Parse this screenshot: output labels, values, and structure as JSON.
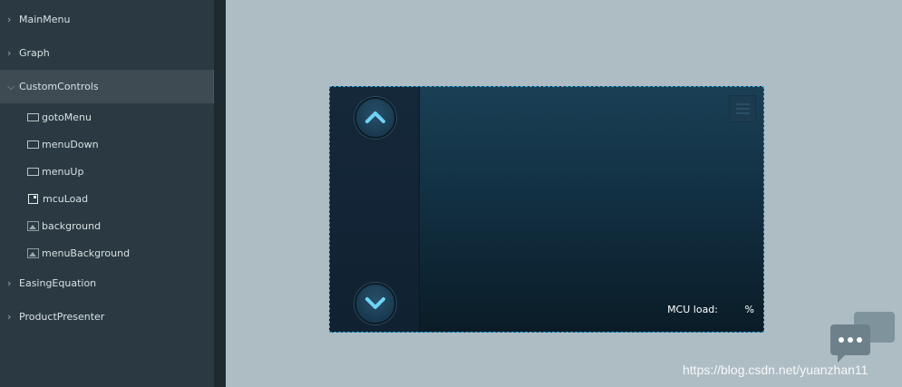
{
  "tree": {
    "top_items": [
      {
        "label": "MainMenu"
      },
      {
        "label": "Graph"
      },
      {
        "label": "CustomControls"
      },
      {
        "label": "EasingEquation"
      },
      {
        "label": "ProductPresenter"
      }
    ],
    "children": [
      {
        "label": "gotoMenu",
        "icon": "button-icon"
      },
      {
        "label": "menuDown",
        "icon": "button-icon"
      },
      {
        "label": "menuUp",
        "icon": "button-icon"
      },
      {
        "label": "mcuLoad",
        "icon": "textarea-icon"
      },
      {
        "label": "background",
        "icon": "image-icon"
      },
      {
        "label": "menuBackground",
        "icon": "image-icon"
      }
    ]
  },
  "canvas": {
    "mcu_label": "MCU load:",
    "mcu_unit": "%"
  },
  "watermark": {
    "text": "https://blog.csdn.net/yuanzhan11"
  },
  "colors": {
    "workspace": "#aebdc4",
    "sidebar": "#2b3a42",
    "selection": "#3e4b52",
    "canvas_border": "#2fb0e8",
    "arrow": "#6fd3f5"
  }
}
